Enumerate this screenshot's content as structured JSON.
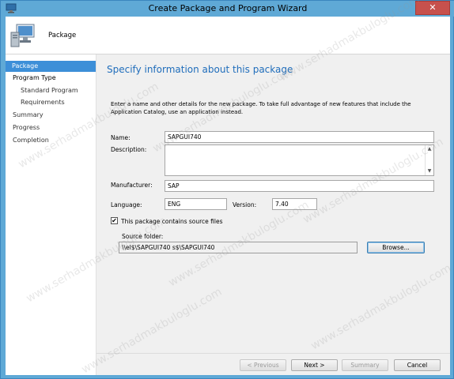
{
  "window": {
    "title": "Create Package and Program Wizard",
    "close_glyph": "✕"
  },
  "header": {
    "heading": "Package"
  },
  "nav": {
    "items": [
      {
        "label": "Package",
        "active": true
      },
      {
        "label": "Program Type"
      },
      {
        "label": "Standard Program"
      },
      {
        "label": "Requirements"
      },
      {
        "label": "Summary"
      },
      {
        "label": "Progress"
      },
      {
        "label": "Completion"
      }
    ]
  },
  "main": {
    "page_title": "Specify information about this package",
    "intro": "Enter a name and other details for the new package. To take full advantage of new features that include the Application Catalog, use an application instead.",
    "name_label": "Name:",
    "name_value": "SAPGUI740",
    "description_label": "Description:",
    "description_value": "",
    "manufacturer_label": "Manufacturer:",
    "manufacturer_value": "SAP",
    "language_label": "Language:",
    "language_value": "ENG",
    "version_label": "Version:",
    "version_value": "7.40",
    "source_checkbox_label": "This package contains source files",
    "source_checked": true,
    "source_folder_label": "Source folder:",
    "source_folder_value": "\\\\el$\\SAPGUI740         s$\\SAPGUI740",
    "browse_label": "Browse..."
  },
  "footer": {
    "previous_label": "< Previous",
    "next_label": "Next >",
    "summary_label": "Summary",
    "cancel_label": "Cancel"
  },
  "watermark": "www.serhadmakbuloglu.com",
  "colors": {
    "titlebar": "#5fa9d6",
    "accent": "#3d8fd8",
    "page_title": "#1f6dbb",
    "close": "#c7514d"
  }
}
